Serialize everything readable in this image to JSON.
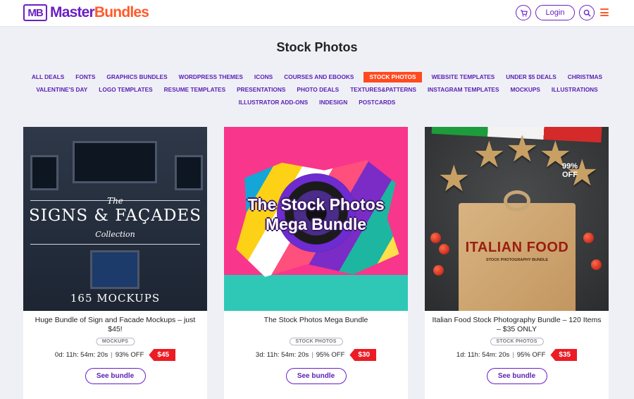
{
  "header": {
    "logo_mark": "MB",
    "logo_text_1": "Master",
    "logo_text_2": "Bundles",
    "login_label": "Login",
    "icons": [
      "cart-icon",
      "search-icon",
      "hamburger-menu-icon"
    ],
    "colors": {
      "brand_purple": "#6b1fc4",
      "brand_orange": "#ff5a2a"
    }
  },
  "page": {
    "title": "Stock Photos"
  },
  "categories": [
    {
      "label": "ALL DEALS",
      "active": false
    },
    {
      "label": "FONTS",
      "active": false
    },
    {
      "label": "GRAPHICS BUNDLES",
      "active": false
    },
    {
      "label": "WORDPRESS THEMES",
      "active": false
    },
    {
      "label": "ICONS",
      "active": false
    },
    {
      "label": "COURSES AND EBOOKS",
      "active": false
    },
    {
      "label": "STOCK PHOTOS",
      "active": true
    },
    {
      "label": "WEBSITE TEMPLATES",
      "active": false
    },
    {
      "label": "UNDER $5 DEALS",
      "active": false
    },
    {
      "label": "CHRISTMAS",
      "active": false
    },
    {
      "label": "VALENTINE'S DAY",
      "active": false
    },
    {
      "label": "LOGO TEMPLATES",
      "active": false
    },
    {
      "label": "RESUME TEMPLATES",
      "active": false
    },
    {
      "label": "PRESENTATIONS",
      "active": false
    },
    {
      "label": "PHOTO DEALS",
      "active": false
    },
    {
      "label": "TEXTURES&PATTERNS",
      "active": false
    },
    {
      "label": "INSTAGRAM TEMPLATES",
      "active": false
    },
    {
      "label": "MOCKUPS",
      "active": false
    },
    {
      "label": "ILLUSTRATIONS",
      "active": false
    },
    {
      "label": "ILLUSTRATOR ADD-ONS",
      "active": false
    },
    {
      "label": "INDESIGN",
      "active": false
    },
    {
      "label": "POSTCARDS",
      "active": false
    }
  ],
  "cards": [
    {
      "title": "Huge Bundle of Sign and Facade Mockups – just $45!",
      "tag": "MOCKUPS",
      "timer": "0d: 11h: 54m: 20s",
      "discount": "93% OFF",
      "price": "$45",
      "button": "See bundle",
      "image_text": {
        "line1": "The",
        "line2": "SIGNS & FAÇADES",
        "line3": "Collection",
        "line4": "165 MOCKUPS"
      }
    },
    {
      "title": "The Stock Photos Mega Bundle",
      "tag": "STOCK PHOTOS",
      "timer": "3d: 11h: 54m: 20s",
      "discount": "95% OFF",
      "price": "$30",
      "button": "See bundle",
      "image_text": {
        "line1": "The Stock Photos",
        "line2": "Mega Bundle"
      }
    },
    {
      "title": "Italian Food Stock Photography Bundle – 120 Items – $35 ONLY",
      "tag": "STOCK PHOTOS",
      "timer": "1d: 11h: 54m: 20s",
      "discount": "95% OFF",
      "price": "$35",
      "button": "See bundle",
      "image_text": {
        "line1": "ITALIAN FOOD",
        "line2": "STOCK PHOTOGRAPHY BUNDLE",
        "badge1": "99%",
        "badge2": "OFF"
      }
    }
  ]
}
